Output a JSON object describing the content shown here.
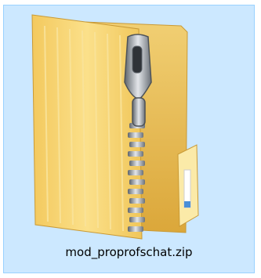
{
  "file": {
    "name": "mod_proprofschat.zip",
    "icon": "zip-folder-icon",
    "selected": true
  },
  "colors": {
    "selection_fill": "#cce8ff",
    "selection_border": "#99d1ff",
    "folder_front": "#f7d774",
    "folder_back": "#e8b84a",
    "zipper_metal": "#8a8f96"
  }
}
